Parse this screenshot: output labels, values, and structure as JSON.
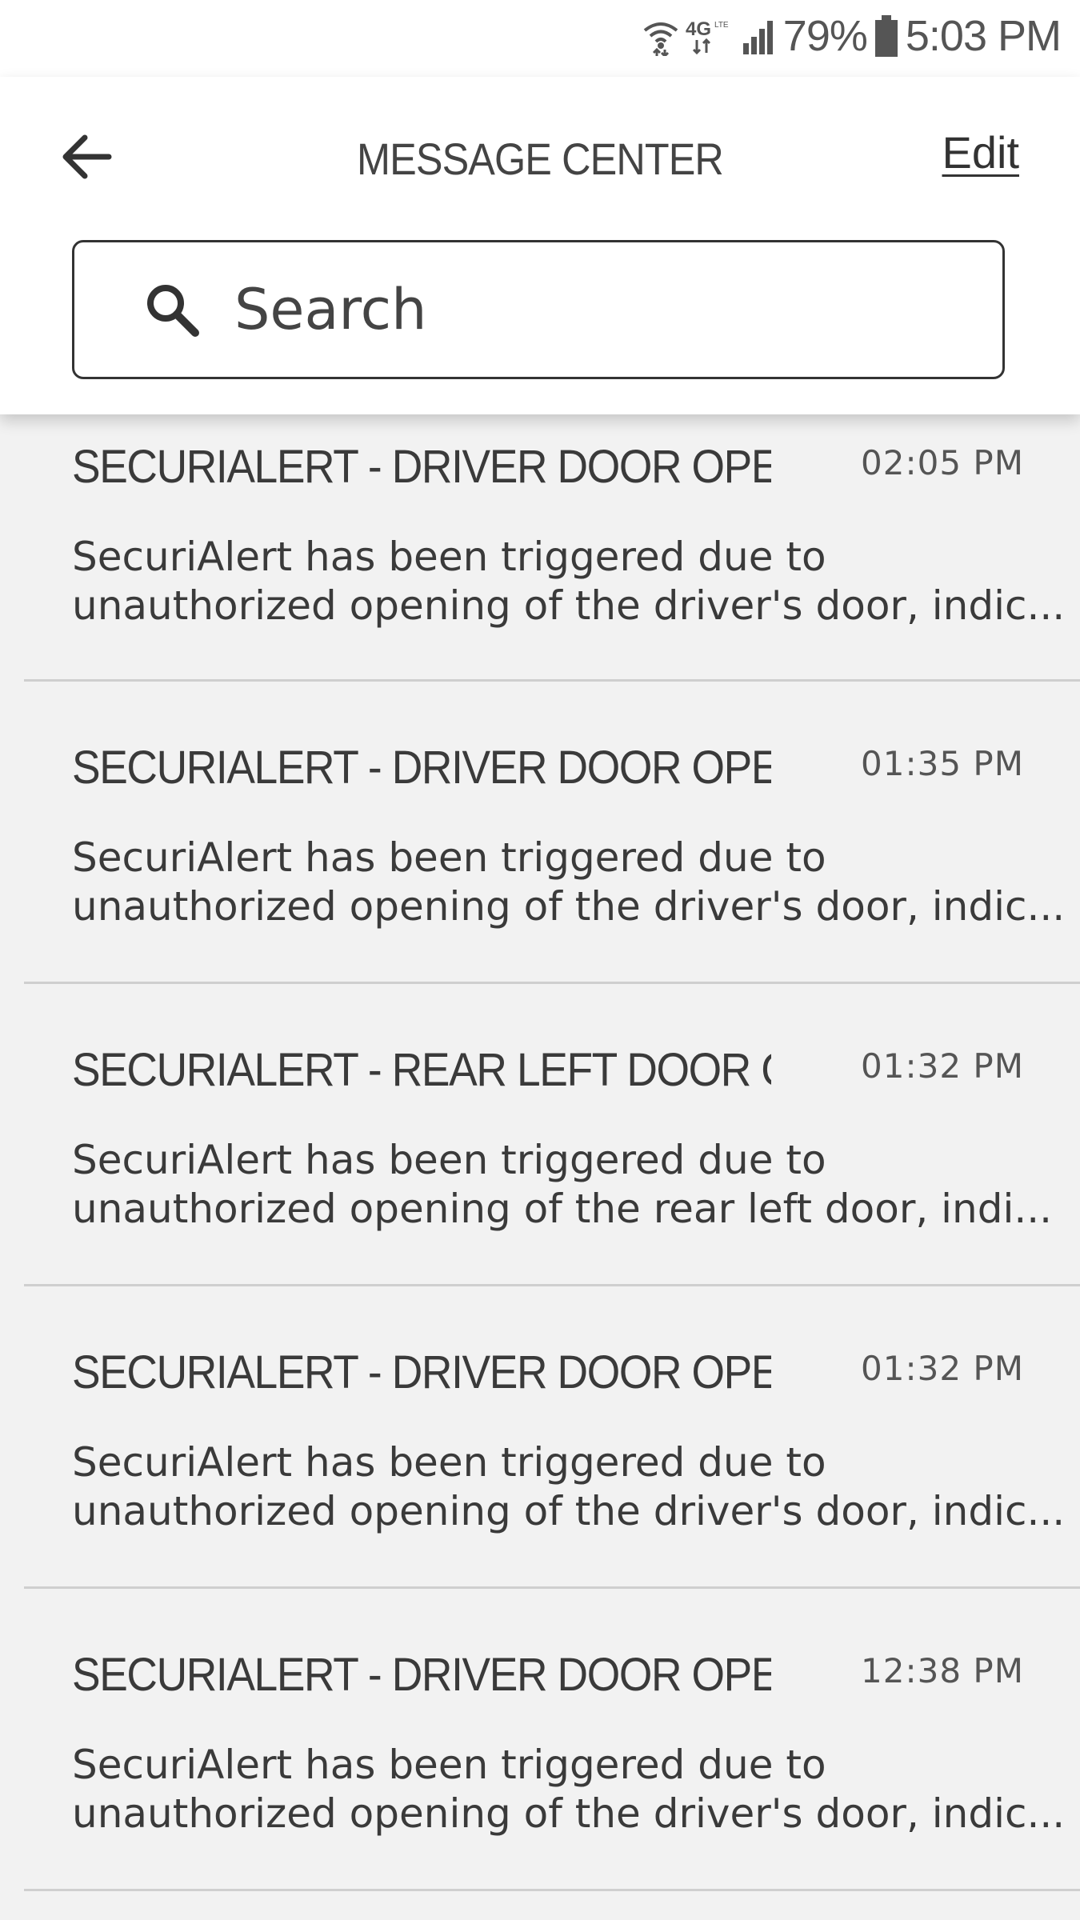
{
  "status_bar": {
    "battery": "79%",
    "time": "5:03 PM",
    "icons": [
      "wifi-icon",
      "4g-lte-icon",
      "signal-icon",
      "battery-icon"
    ]
  },
  "header": {
    "title": "MESSAGE CENTER",
    "edit_label": "Edit",
    "back_icon": "arrow-left-icon"
  },
  "search": {
    "placeholder": "Search",
    "icon": "search-icon"
  },
  "messages": [
    {
      "title": "SECURIALERT - DRIVER DOOR OPENED",
      "time": "02:05 PM",
      "body_line1": "SecuriAlert has been triggered due to",
      "body_line2": "unauthorized opening of the driver's door, indic..."
    },
    {
      "title": "SECURIALERT - DRIVER DOOR OPENED",
      "time": "01:35 PM",
      "body_line1": "SecuriAlert has been triggered due to",
      "body_line2": "unauthorized opening of the driver's door, indic..."
    },
    {
      "title": "SECURIALERT - REAR LEFT DOOR OPE...",
      "time": "01:32 PM",
      "body_line1": "SecuriAlert has been triggered due to",
      "body_line2": "unauthorized opening of the rear left door, indi..."
    },
    {
      "title": "SECURIALERT - DRIVER DOOR OPENED",
      "time": "01:32 PM",
      "body_line1": "SecuriAlert has been triggered due to",
      "body_line2": "unauthorized opening of the driver's door, indic..."
    },
    {
      "title": "SECURIALERT - DRIVER DOOR OPENED",
      "time": "12:38 PM",
      "body_line1": "SecuriAlert has been triggered due to",
      "body_line2": "unauthorized opening of the driver's door, indic..."
    }
  ],
  "colors": {
    "background": "#f2f2f2",
    "header_bg": "#ffffff",
    "text": "#333333",
    "divider": "#cfcfcf"
  }
}
